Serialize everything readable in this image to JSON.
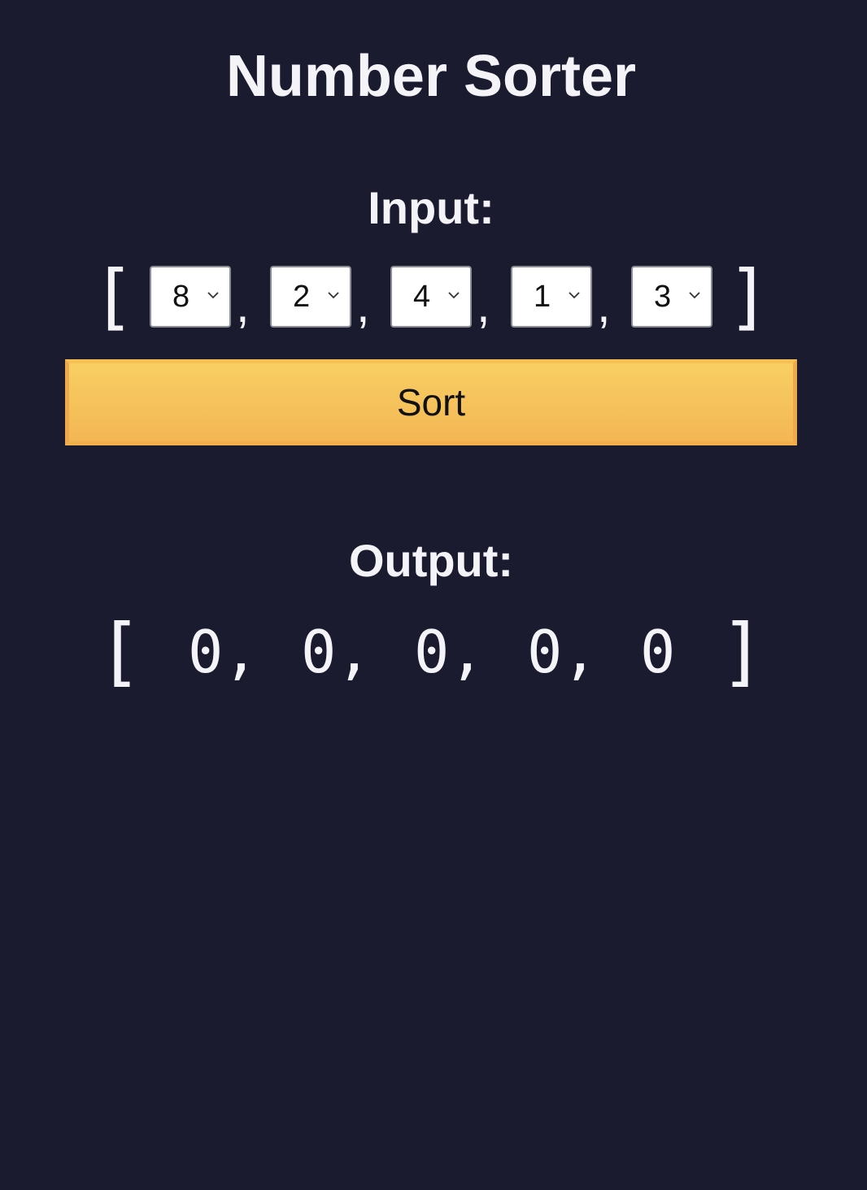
{
  "title": "Number Sorter",
  "input": {
    "label": "Input:",
    "open_bracket": "[",
    "close_bracket": "]",
    "separator": ",",
    "selects": [
      {
        "value": "8"
      },
      {
        "value": "2"
      },
      {
        "value": "4"
      },
      {
        "value": "1"
      },
      {
        "value": "3"
      }
    ]
  },
  "sort_button": {
    "label": "Sort"
  },
  "output": {
    "label": "Output:",
    "open_bracket": "[",
    "close_bracket": "]",
    "separator": ",",
    "values": [
      "0",
      "0",
      "0",
      "0",
      "0"
    ]
  },
  "colors": {
    "background": "#1b1b2f",
    "text": "#f4f4f8",
    "button_top": "#f8cf63",
    "button_bottom": "#f3b654"
  },
  "icons": {
    "select_arrow": "chevron-down-icon"
  }
}
